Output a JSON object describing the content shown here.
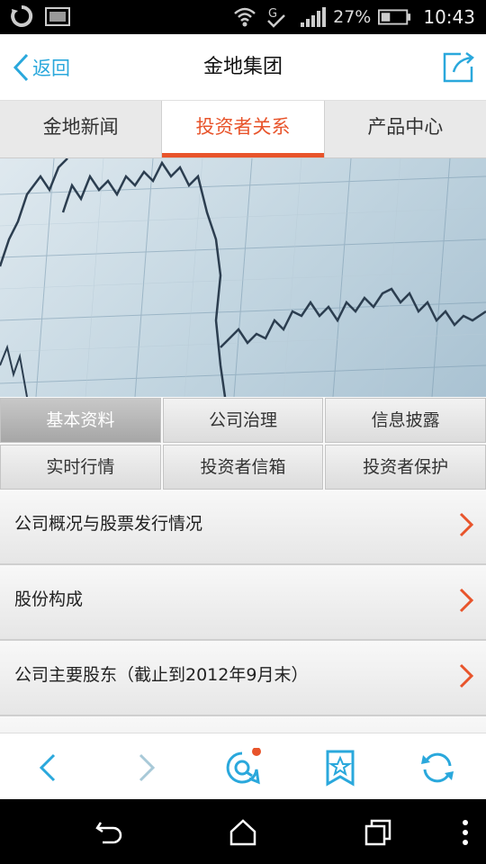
{
  "status_bar": {
    "battery_percent": "27%",
    "time": "10:43",
    "icons": [
      "sync-icon",
      "image-icon",
      "wifi-icon",
      "g-signal-icon",
      "cell-signal-icon",
      "battery-icon"
    ]
  },
  "header": {
    "back_label": "返回",
    "title": "金地集团",
    "share_icon": "share-icon"
  },
  "tabs": [
    {
      "label": "金地新闻",
      "active": false
    },
    {
      "label": "投资者关系",
      "active": true
    },
    {
      "label": "产品中心",
      "active": false
    }
  ],
  "sub_tabs": [
    {
      "label": "基本资料",
      "active": true
    },
    {
      "label": "公司治理",
      "active": false
    },
    {
      "label": "信息披露",
      "active": false
    },
    {
      "label": "实时行情",
      "active": false
    },
    {
      "label": "投资者信箱",
      "active": false
    },
    {
      "label": "投资者保护",
      "active": false
    }
  ],
  "list_items": [
    {
      "label": "公司概况与股票发行情况"
    },
    {
      "label": "股份构成"
    },
    {
      "label": "公司主要股东（截止到2012年9月末）"
    },
    {
      "label": ""
    }
  ],
  "toolbar": {
    "icons": [
      "back-arrow-icon",
      "forward-arrow-icon",
      "search-bubble-icon",
      "bookmark-star-icon",
      "refresh-icon"
    ],
    "notification_dot_color": "#e8542b"
  },
  "colors": {
    "accent": "#e8542b",
    "link_blue": "#2aa8dc"
  },
  "nav_bar": {
    "icons": [
      "android-back-icon",
      "android-home-icon",
      "android-recents-icon",
      "overflow-menu-icon"
    ]
  }
}
